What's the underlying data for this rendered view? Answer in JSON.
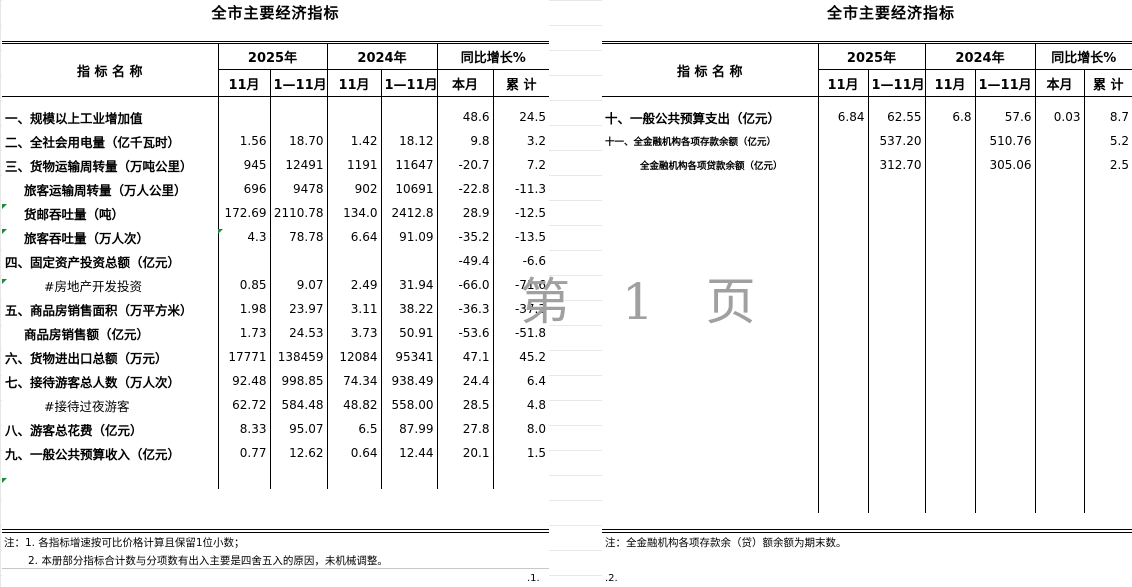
{
  "left": {
    "title": "全市主要经济指标",
    "headers": {
      "name": "指 标 名 称",
      "y2025": "2025年",
      "y2024": "2024年",
      "growth": "同比增长%",
      "m": "11月",
      "ytd": "1—11月",
      "month": "本月",
      "cum": "累 计"
    },
    "rows": [
      {
        "label": "一、规模以上工业增加值",
        "v1": "",
        "v2": "",
        "v3": "",
        "v4": "",
        "g1": "48.6",
        "g2": "24.5"
      },
      {
        "label": "二、全社会用电量（亿千瓦时）",
        "v1": "1.56",
        "v2": "18.70",
        "v3": "1.42",
        "v4": "18.12",
        "g1": "9.8",
        "g2": "3.2"
      },
      {
        "label": "三、货物运输周转量（万吨公里）",
        "v1": "945",
        "v2": "12491",
        "v3": "1191",
        "v4": "11647",
        "g1": "-20.7",
        "g2": "7.2"
      },
      {
        "label": "旅客运输周转量（万人公里）",
        "v1": "696",
        "v2": "9478",
        "v3": "902",
        "v4": "10691",
        "g1": "-22.8",
        "g2": "-11.3"
      },
      {
        "label": "货邮吞吐量（吨）",
        "v1": "172.69",
        "v2": "2110.78",
        "v3": "134.0",
        "v4": "2412.8",
        "g1": "28.9",
        "g2": "-12.5"
      },
      {
        "label": "旅客吞吐量（万人次）",
        "v1": "4.3",
        "v2": "78.78",
        "v3": "6.64",
        "v4": "91.09",
        "g1": "-35.2",
        "g2": "-13.5"
      },
      {
        "label": "四、固定资产投资总额（亿元）",
        "v1": "",
        "v2": "",
        "v3": "",
        "v4": "",
        "g1": "-49.4",
        "g2": "-6.6"
      },
      {
        "label": "#房地产开发投资",
        "v1": "0.85",
        "v2": "9.07",
        "v3": "2.49",
        "v4": "31.94",
        "g1": "-66.0",
        "g2": "-71.6"
      },
      {
        "label": "五、商品房销售面积（万平方米）",
        "v1": "1.98",
        "v2": "23.97",
        "v3": "3.11",
        "v4": "38.22",
        "g1": "-36.3",
        "g2": "-37.3"
      },
      {
        "label": "商品房销售额（亿元）",
        "v1": "1.73",
        "v2": "24.53",
        "v3": "3.73",
        "v4": "50.91",
        "g1": "-53.6",
        "g2": "-51.8"
      },
      {
        "label": "六、货物进出口总额（万元）",
        "v1": "17771",
        "v2": "138459",
        "v3": "12084",
        "v4": "95341",
        "g1": "47.1",
        "g2": "45.2"
      },
      {
        "label": "七、接待游客总人数（万人次）",
        "v1": "92.48",
        "v2": "998.85",
        "v3": "74.34",
        "v4": "938.49",
        "g1": "24.4",
        "g2": "6.4"
      },
      {
        "label": "#接待过夜游客",
        "v1": "62.72",
        "v2": "584.48",
        "v3": "48.82",
        "v4": "558.00",
        "g1": "28.5",
        "g2": "4.8"
      },
      {
        "label": "八、游客总花费（亿元）",
        "v1": "8.33",
        "v2": "95.07",
        "v3": "6.5",
        "v4": "87.99",
        "g1": "27.8",
        "g2": "8.0"
      },
      {
        "label": "九、一般公共预算收入（亿元）",
        "v1": "0.77",
        "v2": "12.62",
        "v3": "0.64",
        "v4": "12.44",
        "g1": "20.1",
        "g2": "1.5"
      }
    ],
    "note1": "注：1. 各指标增速按可比价格计算且保留1位小数；",
    "note2": "2. 本册部分指标合计数与分项数有出入主要是四舍五入的原因，未机械调整。",
    "page": ".1."
  },
  "right": {
    "title": "全市主要经济指标",
    "headers": {
      "name": "指 标 名 称",
      "y2025": "2025年",
      "y2024": "2024年",
      "growth": "同比增长%",
      "m": "11月",
      "ytd": "1—11月",
      "month": "本月",
      "cum": "累 计"
    },
    "rows": [
      {
        "label": "十、一般公共预算支出（亿元）",
        "v1": "6.84",
        "v2": "62.55",
        "v3": "6.8",
        "v4": "57.6",
        "g1": "0.03",
        "g2": "8.7"
      },
      {
        "label": "十一、全金融机构各项存款余额（亿元）",
        "v1": "",
        "v2": "537.20",
        "v3": "",
        "v4": "510.76",
        "g1": "",
        "g2": "5.2"
      },
      {
        "label": "全金融机构各项贷款余额（亿元）",
        "v1": "",
        "v2": "312.70",
        "v3": "",
        "v4": "305.06",
        "g1": "",
        "g2": "2.5"
      }
    ],
    "note1": "注：全金融机构各项存款余（贷）额余额为期末数。",
    "page": ".2."
  },
  "watermark": "第 1 页"
}
